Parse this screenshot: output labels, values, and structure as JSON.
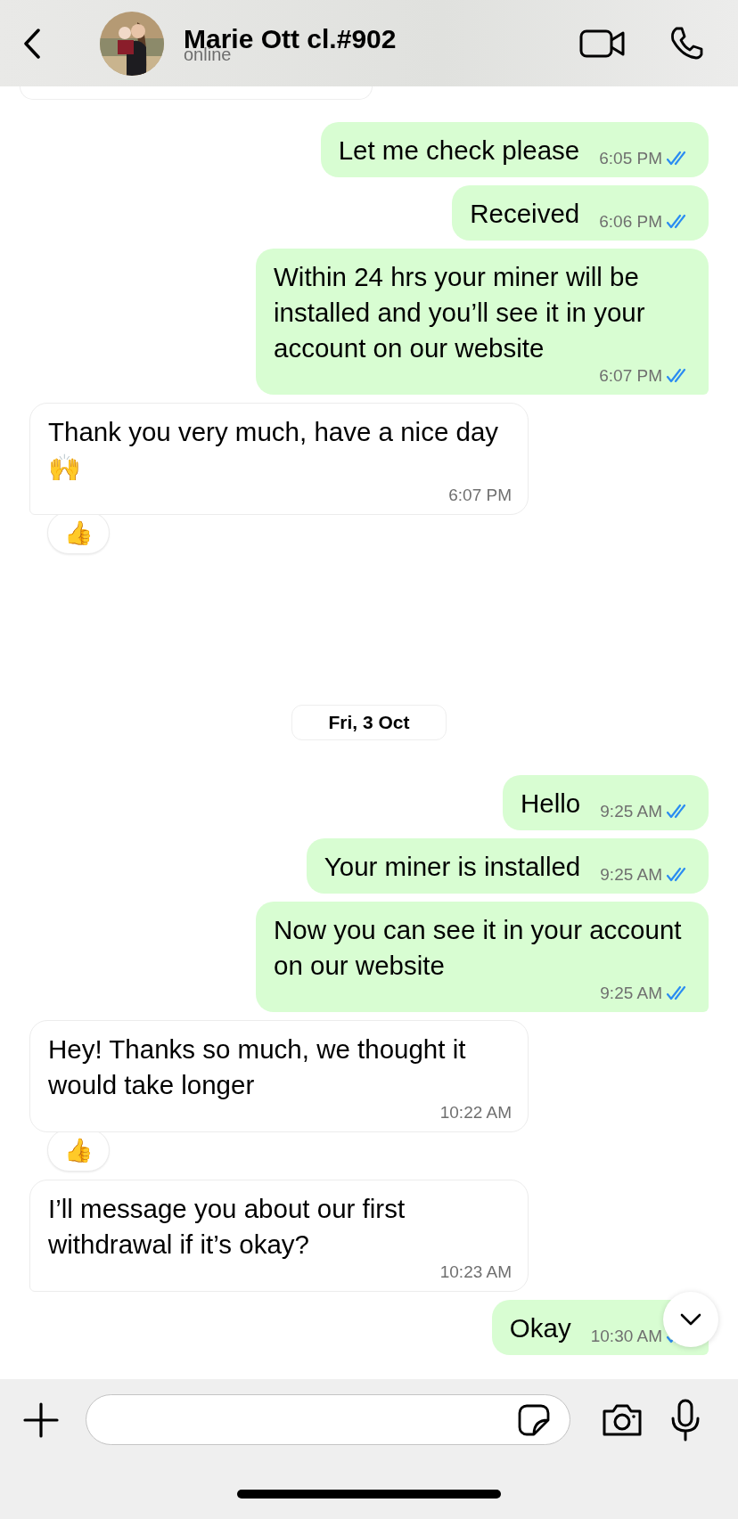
{
  "header": {
    "name": "Marie Ott cl.#902",
    "status": "online"
  },
  "messages": [
    {
      "kind": "partial",
      "outgoing": false
    },
    {
      "kind": "message",
      "outgoing": true,
      "text": "Let me check please",
      "time": "6:05 PM",
      "read": true
    },
    {
      "kind": "message",
      "outgoing": true,
      "text": "Received",
      "time": "6:06 PM",
      "read": true
    },
    {
      "kind": "message",
      "outgoing": true,
      "text": "Within 24 hrs your miner will be installed and you’ll see it in your account on our website",
      "time": "6:07 PM",
      "read": true,
      "tail": true
    },
    {
      "kind": "message",
      "outgoing": false,
      "text": "Thank you very much, have a nice day 🙌",
      "time": "6:07 PM",
      "reaction": "👍",
      "tail": true
    },
    {
      "kind": "date",
      "text": "Fri, 3 Oct"
    },
    {
      "kind": "message",
      "outgoing": true,
      "text": "Hello",
      "time": "9:25 AM",
      "read": true
    },
    {
      "kind": "message",
      "outgoing": true,
      "text": "Your miner is installed",
      "time": "9:25 AM",
      "read": true
    },
    {
      "kind": "message",
      "outgoing": true,
      "text": "Now you can see it in your account on our website",
      "time": "9:25 AM",
      "read": true,
      "tail": true
    },
    {
      "kind": "message",
      "outgoing": false,
      "text": "Hey! Thanks so much, we thought it would take longer",
      "time": "10:22 AM",
      "reaction": "👍"
    },
    {
      "kind": "message",
      "outgoing": false,
      "text": "I’ll message you about our first withdrawal if it’s okay?",
      "time": "10:23 AM",
      "tail": true
    },
    {
      "kind": "message",
      "outgoing": true,
      "text": "Okay",
      "time": "10:30 AM",
      "read": true,
      "tail": true
    }
  ]
}
